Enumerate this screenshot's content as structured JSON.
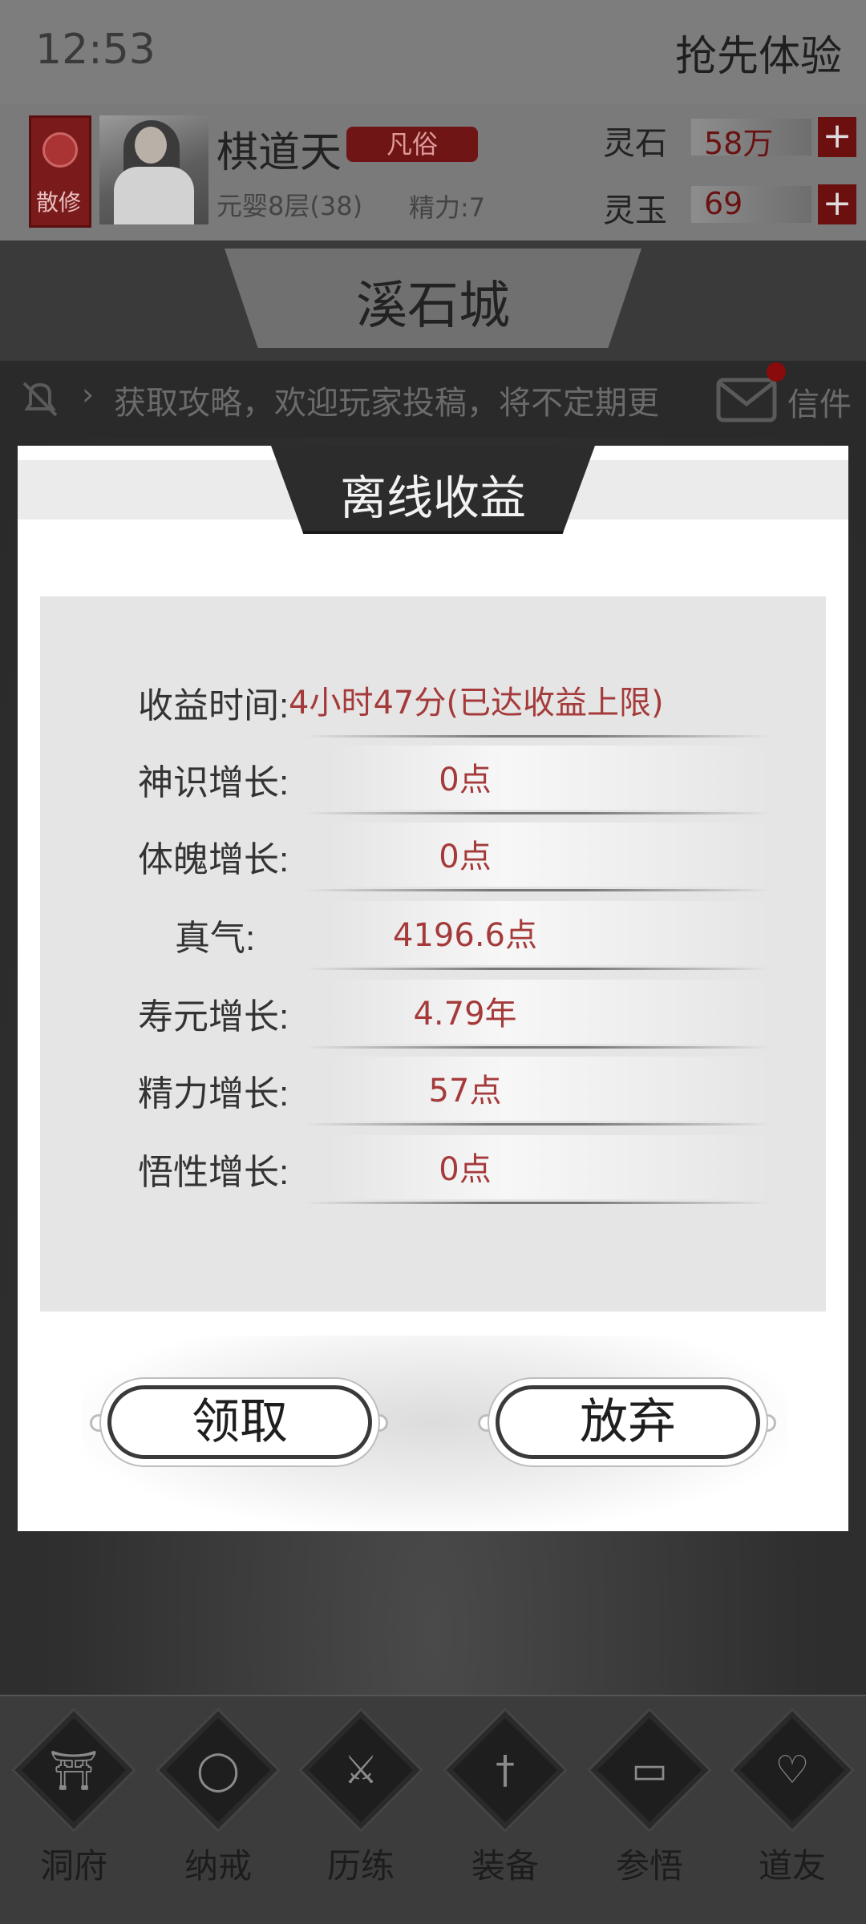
{
  "status_bar": {
    "time": "12:53",
    "early_access": "抢先体验"
  },
  "player": {
    "sect": "散修",
    "name": "棋道天",
    "rank": "凡俗",
    "realm": "元婴8层(38)",
    "energy": "精力:7"
  },
  "currencies": [
    {
      "label": "灵石",
      "value": "58万",
      "add": "+"
    },
    {
      "label": "灵玉",
      "value": "69",
      "add": "+"
    }
  ],
  "city": {
    "name": "溪石城"
  },
  "notice": {
    "arrow": "›",
    "text": "获取攻略，欢迎玩家投稿，将不定期更",
    "mail_label": "信件"
  },
  "modal": {
    "title": "离线收益",
    "rows": [
      {
        "label": "收益时间:",
        "value": "4小时47分(已达收益上限)"
      },
      {
        "label": "神识增长:",
        "value": "0点"
      },
      {
        "label": "体魄增长:",
        "value": "0点"
      },
      {
        "label": "真气:",
        "value": "4196.6点"
      },
      {
        "label": "寿元增长:",
        "value": "4.79年"
      },
      {
        "label": "精力增长:",
        "value": "57点"
      },
      {
        "label": "悟性增长:",
        "value": "0点"
      }
    ],
    "claim_label": "领取",
    "abandon_label": "放弃"
  },
  "nav": [
    {
      "label": "洞府",
      "icon": "gate-icon"
    },
    {
      "label": "纳戒",
      "icon": "ring-icon"
    },
    {
      "label": "历练",
      "icon": "crossed-swords-icon"
    },
    {
      "label": "装备",
      "icon": "dagger-icon"
    },
    {
      "label": "参悟",
      "icon": "book-icon"
    },
    {
      "label": "道友",
      "icon": "handshake-icon"
    }
  ],
  "colors": {
    "accent_red": "#a53a3a",
    "dark_red": "#6b0f0f"
  }
}
